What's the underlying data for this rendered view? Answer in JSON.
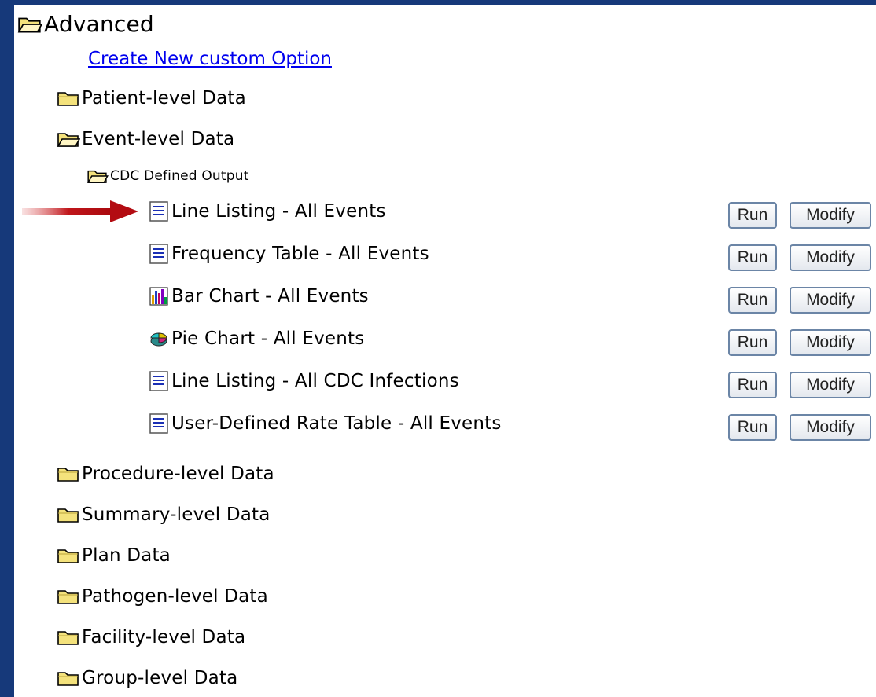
{
  "tree": {
    "root_label": "Advanced",
    "create_link": "Create New custom Option",
    "patient": "Patient-level Data",
    "event": "Event-level Data",
    "cdc": "CDC Defined Output",
    "reports": [
      {
        "label": "Line Listing - All Events",
        "icon": "line-listing-icon"
      },
      {
        "label": "Frequency Table - All Events",
        "icon": "frequency-table-icon"
      },
      {
        "label": "Bar Chart - All Events",
        "icon": "bar-chart-icon"
      },
      {
        "label": "Pie Chart - All Events",
        "icon": "pie-chart-icon"
      },
      {
        "label": "Line Listing - All CDC Infections",
        "icon": "line-listing-icon"
      },
      {
        "label": "User-Defined Rate Table - All Events",
        "icon": "rate-table-icon"
      }
    ],
    "folders_after": [
      "Procedure-level Data",
      "Summary-level Data",
      "Plan Data",
      "Pathogen-level Data",
      "Facility-level Data",
      "Group-level Data"
    ]
  },
  "buttons": {
    "run": "Run",
    "modify": "Modify"
  },
  "colors": {
    "background": "#16397a",
    "link": "#0000ee",
    "arrow": "#c0161b",
    "folder": "#f4e27c"
  }
}
